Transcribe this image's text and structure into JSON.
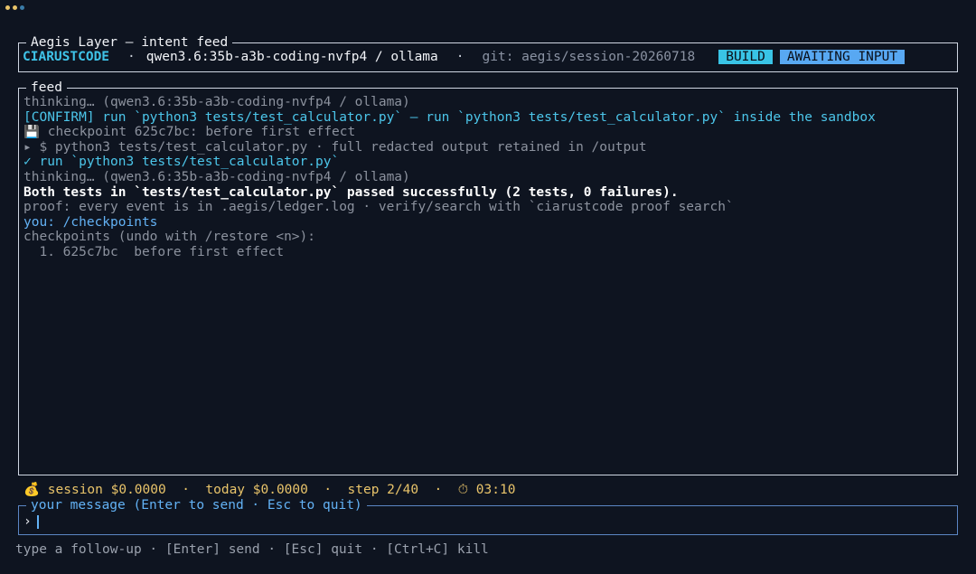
{
  "colors": {
    "background": "#0e1420",
    "brand": "#3fc3e8",
    "dot_1": "#e9c46a",
    "dot_2": "#e9c46a",
    "dot_3": "#3a7ca8"
  },
  "header": {
    "title": "Aegis Layer — intent feed",
    "brand": "CIARUSTCODE",
    "sep": "·",
    "model": "qwen3.6:35b-a3b-coding-nvfp4 / ollama",
    "git": "git: aegis/session-20260718",
    "badge_mode": "BUILD",
    "badge_state": "AWAITING INPUT"
  },
  "feed": {
    "title": "feed",
    "lines": [
      "thinking… (qwen3.6:35b-a3b-coding-nvfp4 / ollama)",
      "[CONFIRM] run `python3 tests/test_calculator.py` — run `python3 tests/test_calculator.py` inside the sandbox",
      "💾 checkpoint 625c7bc: before first effect",
      "▸ $ python3 tests/test_calculator.py · full redacted output retained in /output",
      "✓ run `python3 tests/test_calculator.py`",
      "thinking… (qwen3.6:35b-a3b-coding-nvfp4 / ollama)",
      "Both tests in `tests/test_calculator.py` passed successfully (2 tests, 0 failures).",
      "proof: every event is in .aegis/ledger.log · verify/search with `ciarustcode proof search`",
      "you: /checkpoints",
      "checkpoints (undo with /restore <n>):",
      "  1. 625c7bc  before first effect"
    ]
  },
  "status": {
    "text": "💰 session $0.0000  ·  today $0.0000  ·  step 2/40  ·  ⏱ 03:10"
  },
  "input": {
    "title": "your message (Enter to send · Esc to quit)",
    "prompt": "›",
    "value": ""
  },
  "hints": {
    "text": "type a follow-up · [Enter] send · [Esc] quit · [Ctrl+C] kill"
  }
}
